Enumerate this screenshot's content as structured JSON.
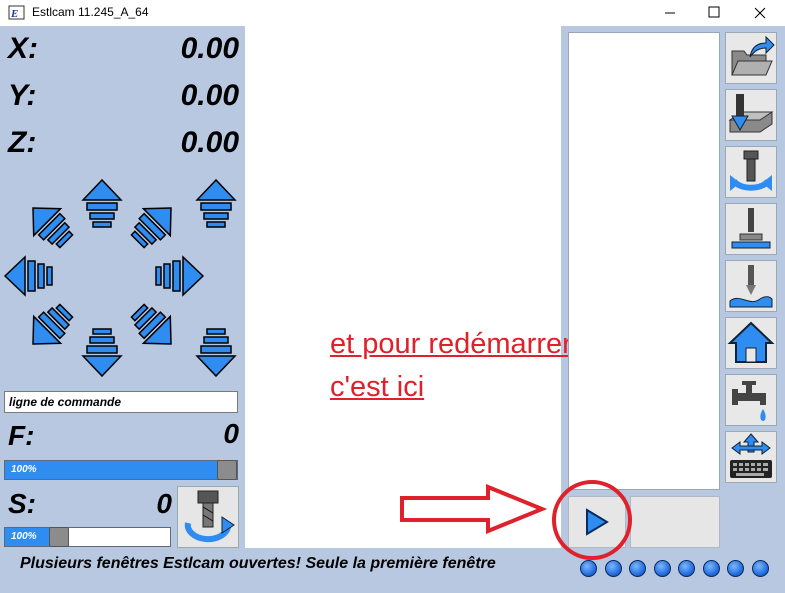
{
  "window": {
    "title": "Estlcam 11.245_A_64"
  },
  "axes": [
    {
      "label": "X:",
      "value": "0.00"
    },
    {
      "label": "Y:",
      "value": "0.00"
    },
    {
      "label": "Z:",
      "value": "0.00"
    }
  ],
  "command": {
    "placeholder": "ligne de commande"
  },
  "feed": {
    "label": "F:",
    "value": "0",
    "override_text": "100%",
    "override_percent": 100
  },
  "spindle": {
    "label": "S:",
    "value": "0",
    "override_text": "100%",
    "override_percent": 30
  },
  "annotation": {
    "line1": "et pour redémarrer",
    "line2": "c'est ici"
  },
  "status": {
    "message": "Plusieurs fenêtres Estlcam ouvertes! Seule la première fenêtre"
  },
  "toolbar": {
    "icons": [
      "open-folder-icon",
      "mill-part-icon",
      "tool-change-icon",
      "tool-length-icon",
      "probe-surface-icon",
      "home-icon",
      "coolant-tap-icon",
      "keyboard-jog-icon"
    ]
  },
  "leds_count": 8,
  "colors": {
    "panel": "#b8c8e0",
    "accent": "#2f8cf0",
    "annotation": "#e0202a"
  }
}
